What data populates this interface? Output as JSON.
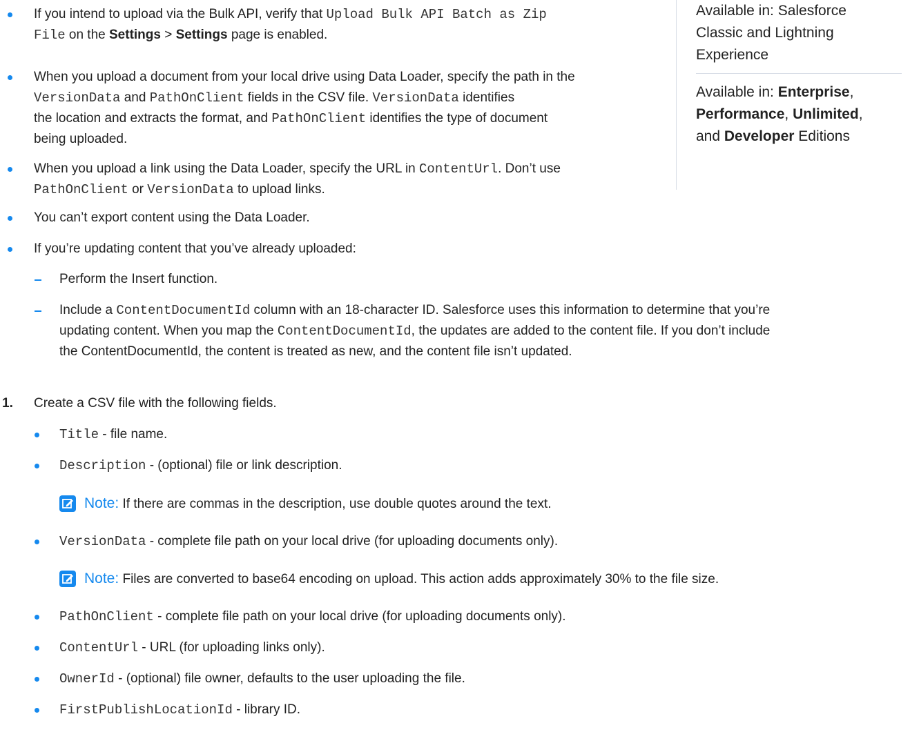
{
  "sidebar": {
    "availability_classic": "Available in: Salesforce Classic and Lightning Experience",
    "avail_prefix": "Available in: ",
    "ed1": "Enterprise",
    "ed2": "Performance",
    "ed3": "Unlimited",
    "ed4": "Developer",
    "and": "and ",
    "editions": " Editions",
    "comma": ","
  },
  "bullets": {
    "b1_a": "If you intend to upload via the Bulk API, verify that ",
    "b1_code1": "Upload Bulk API Batch as Zip",
    "b1_code2": "File",
    "b1_b": " on the ",
    "b1_settings1": "Settings",
    "b1_gt": " > ",
    "b1_settings2": "Settings",
    "b1_c": " page is enabled.",
    "b2_a": "When you upload a document from your local drive using Data Loader, specify the path in the",
    "b2_code1": "VersionData",
    "b2_and": " and ",
    "b2_code2": "PathOnClient",
    "b2_b": " fields in the CSV file. ",
    "b2_code3": "VersionData",
    "b2_c": " identifies",
    "b2_d": "the location and extracts the format, and ",
    "b2_code4": "PathOnClient",
    "b2_e": " identifies the type of document",
    "b2_f": "being uploaded.",
    "b3_a": "When you upload a link using the Data Loader, specify the URL in ",
    "b3_code1": "ContentUrl",
    "b3_b": ". Don’t use",
    "b3_code2": "PathOnClient",
    "b3_or": " or ",
    "b3_code3": "VersionData",
    "b3_c": " to upload links.",
    "b4": "You can’t export content using the Data Loader.",
    "b5": "If you’re updating content that you’ve already uploaded:",
    "d1": "Perform the Insert function.",
    "d2_a": "Include a ",
    "d2_code1": "ContentDocumentId",
    "d2_b": " column with an 18-character ID. Salesforce uses this information to determine that you’re",
    "d2_c": "updating content. When you map the ",
    "d2_code2": "ContentDocumentId",
    "d2_d": ", the updates are added to the content file. If you don’t include",
    "d2_e": "the ContentDocumentId, the content is treated as new, and the content file isn’t updated."
  },
  "step1": {
    "number": "1.",
    "text": "Create a CSV file with the following fields.",
    "fields": [
      {
        "code": "Title",
        "desc": " - file name."
      },
      {
        "code": "Description",
        "desc": " - (optional) file or link description."
      },
      {
        "code": "VersionData",
        "desc": " - complete file path on your local drive (for uploading documents only)."
      },
      {
        "code": "PathOnClient",
        "desc": " - complete file path on your local drive (for uploading documents only)."
      },
      {
        "code": "ContentUrl",
        "desc": " - URL (for uploading links only)."
      },
      {
        "code": "OwnerId",
        "desc": " - (optional) file owner, defaults to the user uploading the file."
      },
      {
        "code": "FirstPublishLocationId",
        "desc": " - library ID."
      }
    ],
    "note1_label": "Note:",
    "note1_text": " If there are commas in the description, use double quotes around the text.",
    "note2_label": "Note:",
    "note2_text": " Files are converted to base64 encoding on upload. This action adds approximately 30% to the file size."
  }
}
